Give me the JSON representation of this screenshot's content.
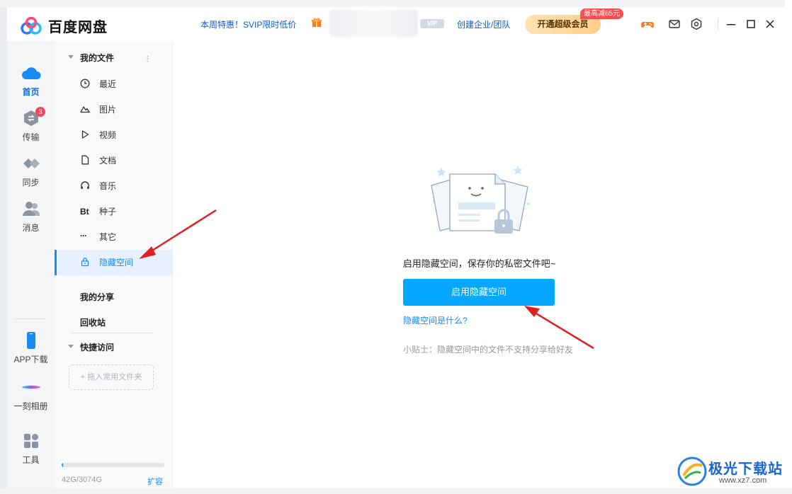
{
  "app": {
    "title": "百度网盘"
  },
  "header": {
    "promo": "本周特惠！SVIP限时低价",
    "vip_badge": "VIP",
    "enterprise": "创建企业/团队",
    "svip_button": "开通超级会员",
    "discount_badge": "最高减65元"
  },
  "left_nav": {
    "items": [
      {
        "label": "首页",
        "icon": "cloud-icon",
        "active": true
      },
      {
        "label": "传输",
        "icon": "transfer-icon",
        "badge": "3"
      },
      {
        "label": "同步",
        "icon": "sync-icon"
      },
      {
        "label": "消息",
        "icon": "message-icon"
      }
    ],
    "bottom": [
      {
        "label": "APP下载",
        "icon": "phone-icon"
      },
      {
        "label": "一刻相册",
        "icon": "album-icon"
      },
      {
        "label": "工具",
        "icon": "tools-icon"
      }
    ]
  },
  "sidebar": {
    "my_files": "我的文件",
    "items": [
      {
        "label": "最近",
        "icon": "clock-icon"
      },
      {
        "label": "图片",
        "icon": "image-icon"
      },
      {
        "label": "视频",
        "icon": "play-icon"
      },
      {
        "label": "文档",
        "icon": "document-icon"
      },
      {
        "label": "音乐",
        "icon": "headphones-icon"
      },
      {
        "label": "种子",
        "icon": "bt-icon",
        "glyph": "Bt"
      },
      {
        "label": "其它",
        "icon": "more-icon",
        "glyph": "···"
      },
      {
        "label": "隐藏空间",
        "icon": "lock-icon",
        "active": true
      }
    ],
    "my_share": "我的分享",
    "recycle": "回收站",
    "quick_access": "快捷访问",
    "drag_hint": "+ 拖入常用文件夹",
    "storage_text": "42G/3074G",
    "storage_used_fraction": 0.014,
    "expand": "扩容"
  },
  "main": {
    "hint_title": "启用隐藏空间，保存你的私密文件吧~",
    "enable_button": "启用隐藏空间",
    "what_link": "隐藏空间是什么?",
    "tip": "小贴士：隐藏空间中的文件不支持分享给好友"
  },
  "watermark": {
    "title": "极光下载站",
    "url": "www.xz7.com"
  },
  "colors": {
    "accent": "#06a7ff",
    "link": "#1a8af5",
    "annotation": "#e02020"
  }
}
